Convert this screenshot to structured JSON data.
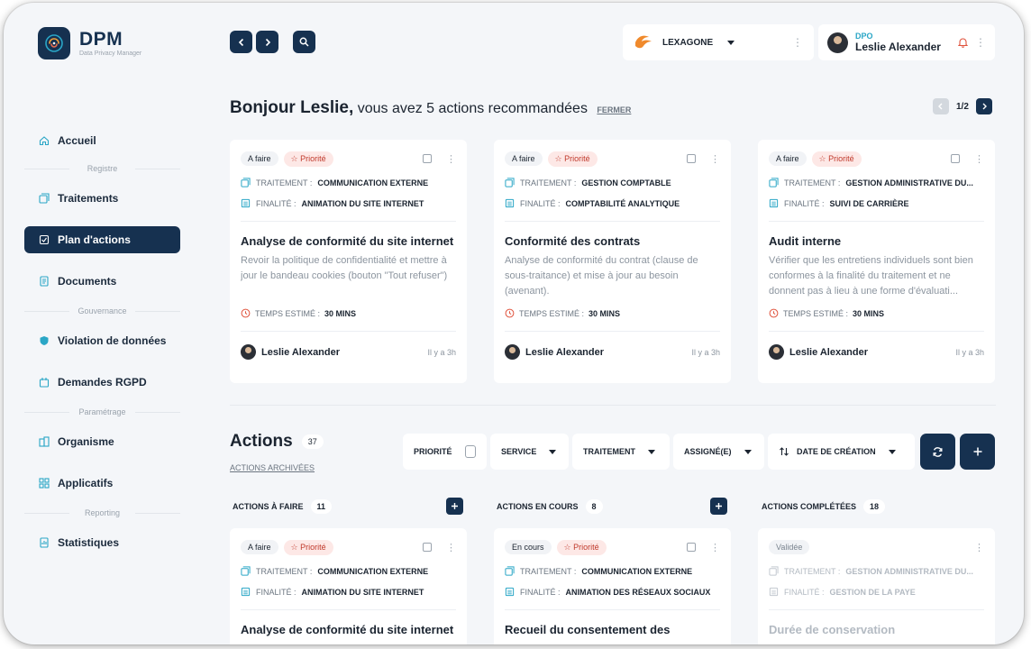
{
  "app": {
    "logo_title": "DPM",
    "logo_subtitle": "Data Privacy Manager"
  },
  "sidebar": {
    "items": [
      {
        "label": "Accueil"
      },
      {
        "section": "Registre"
      },
      {
        "label": "Traitements"
      },
      {
        "label": "Plan d'actions",
        "active": true
      },
      {
        "label": "Documents"
      },
      {
        "section": "Gouvernance"
      },
      {
        "label": "Violation de données"
      },
      {
        "label": "Demandes RGPD"
      },
      {
        "section": "Paramétrage"
      },
      {
        "label": "Organisme"
      },
      {
        "label": "Applicatifs"
      },
      {
        "section": "Reporting"
      },
      {
        "label": "Statistiques"
      }
    ]
  },
  "topbar": {
    "organization": "LEXAGONE",
    "user_role": "DPO",
    "user_name": "Leslie Alexander"
  },
  "greeting": {
    "name": "Bonjour Leslie,",
    "text": " vous avez 5 actions recommandées",
    "close": "FERMER",
    "pager": "1/2"
  },
  "labels": {
    "traitement": "TRAITEMENT :",
    "finalite": "FINALITÉ :",
    "temps": "TEMPS ESTIMÉ :"
  },
  "recommended": [
    {
      "status": "A faire",
      "priority": "Priorité",
      "traitement": "COMMUNICATION EXTERNE",
      "finalite": "ANIMATION DU SITE INTERNET",
      "title": "Analyse de conformité du site internet",
      "description": "Revoir la politique de confidentialité et mettre à jour le bandeau cookies (bouton \"Tout refuser\")",
      "time": "30 MINS",
      "assignee": "Leslie Alexander",
      "ago": "Il y a 3h"
    },
    {
      "status": "A faire",
      "priority": "Priorité",
      "traitement": "GESTION COMPTABLE",
      "finalite": "COMPTABILITÉ ANALYTIQUE",
      "title": "Conformité des contrats",
      "description": "Analyse de conformité du contrat (clause de sous-traitance) et mise à jour au besoin (avenant).",
      "time": "30 MINS",
      "assignee": "Leslie Alexander",
      "ago": "Il y a 3h"
    },
    {
      "status": "A faire",
      "priority": "Priorité",
      "traitement": "GESTION ADMINISTRATIVE DU...",
      "finalite": "SUIVI DE CARRIÈRE",
      "title": "Audit interne",
      "description": "Vérifier que les entretiens individuels sont bien conformes à la finalité du traitement et ne donnent pas à lieu à une forme d'évaluati...",
      "time": "30 MINS",
      "assignee": "Leslie Alexander",
      "ago": "Il y a 3h"
    }
  ],
  "actions": {
    "title": "Actions",
    "count": "37",
    "archived": "ACTIONS ARCHIVÉES",
    "filters": {
      "priority": "PRIORITÉ",
      "service": "SERVICE",
      "traitement": "TRAITEMENT",
      "assignee": "ASSIGNÉ(E)",
      "sort": "DATE DE CRÉATION"
    },
    "columns": [
      {
        "title": "ACTIONS À FAIRE",
        "count": "11"
      },
      {
        "title": "ACTIONS EN COURS",
        "count": "8"
      },
      {
        "title": "ACTIONS COMPLÉTÉES",
        "count": "18"
      }
    ],
    "cards": [
      {
        "status": "A faire",
        "priority": "Priorité",
        "traitement": "COMMUNICATION EXTERNE",
        "finalite": "ANIMATION DU SITE INTERNET",
        "title": "Analyse de conformité du site internet"
      },
      {
        "status": "En cours",
        "priority": "Priorité",
        "traitement": "COMMUNICATION EXTERNE",
        "finalite": "ANIMATION DES RÉSEAUX SOCIAUX",
        "title": "Recueil du consentement des"
      },
      {
        "status": "Validée",
        "traitement": "GESTION ADMINISTRATIVE DU...",
        "finalite": "GESTION DE LA PAYE",
        "title": "Durée de conservation"
      }
    ]
  },
  "colors": {
    "primary": "#163150",
    "accent": "#2aa6c6",
    "priority": "#c0392b",
    "background": "#f4f6f9"
  }
}
